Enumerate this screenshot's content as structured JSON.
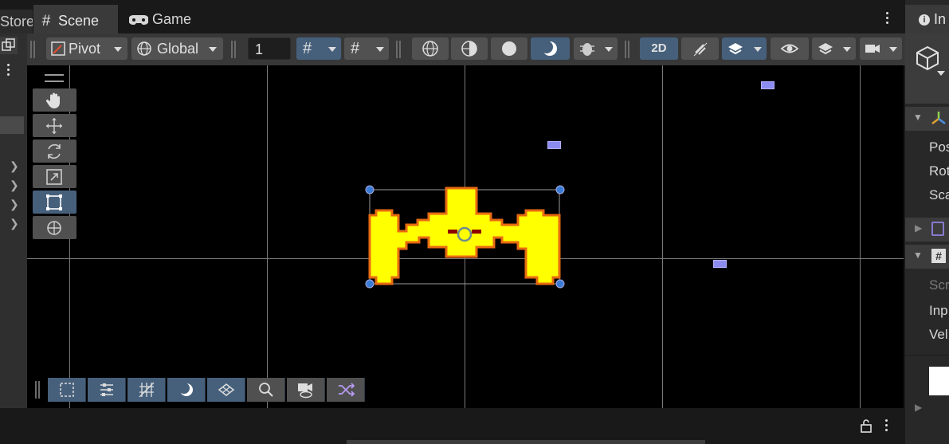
{
  "tabs": {
    "store_label": "Store",
    "scene_label": "Scene",
    "game_label": "Game",
    "inspector_label": "In"
  },
  "toolbar": {
    "pivot_label": "Pivot",
    "global_label": "Global",
    "grid_snap_value": "1",
    "mode_2d_label": "2D"
  },
  "inspector": {
    "transform_rows": [
      "Pos",
      "Rot",
      "Sca"
    ],
    "script_rows": [
      "Scr",
      "Inp",
      "Vel"
    ]
  },
  "colors": {
    "ship_fill": "#ffff00",
    "ship_outline": "#e86a10",
    "ship_eye": "#8b0000",
    "active_button": "#46607c",
    "handle": "#3a7bd5",
    "marker": "#8c8cf0"
  },
  "icons": {
    "scene_tab": "hash-icon",
    "game_tab": "gamepad-icon",
    "hand_tool": "hand-icon",
    "move_tool": "move-icon",
    "rotate_tool": "rotate-icon",
    "scale_tool": "scale-icon",
    "rect_tool": "rect-icon",
    "transform_tool": "transform-icon"
  }
}
